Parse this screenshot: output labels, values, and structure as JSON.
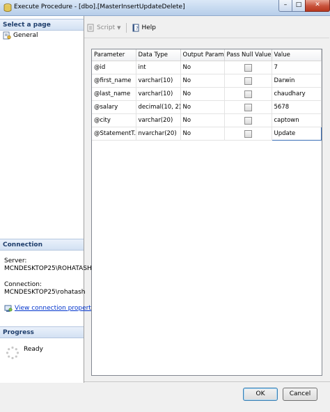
{
  "window": {
    "title": "Execute Procedure - [dbo].[MasterInsertUpdateDelete]",
    "controls": {
      "minimize": "–",
      "maximize": "□",
      "close": "✕"
    }
  },
  "left_pane": {
    "select_page": {
      "header": "Select a page",
      "items": [
        {
          "label": "General",
          "icon": "page-properties-icon"
        }
      ]
    },
    "connection": {
      "header": "Connection",
      "server_label": "Server:",
      "server_value": "MCNDESKTOP25\\ROHATASH",
      "connection_label": "Connection:",
      "connection_value": "MCNDESKTOP25\\rohatash",
      "view_link": "View connection properties"
    },
    "progress": {
      "header": "Progress",
      "status": "Ready"
    }
  },
  "toolbar": {
    "script_label": "Script",
    "help_label": "Help"
  },
  "grid": {
    "columns": [
      "Parameter",
      "Data Type",
      "Output Parame...",
      "Pass Null Value",
      "Value"
    ],
    "rows": [
      {
        "parameter": "@id",
        "data_type": "int",
        "output": "No",
        "pass_null": false,
        "value": "7"
      },
      {
        "parameter": "@first_name",
        "data_type": "varchar(10)",
        "output": "No",
        "pass_null": false,
        "value": "Darwin"
      },
      {
        "parameter": "@last_name",
        "data_type": "varchar(10)",
        "output": "No",
        "pass_null": false,
        "value": "chaudhary"
      },
      {
        "parameter": "@salary",
        "data_type": "decimal(10, 2)",
        "output": "No",
        "pass_null": false,
        "value": "5678"
      },
      {
        "parameter": "@city",
        "data_type": "varchar(20)",
        "output": "No",
        "pass_null": false,
        "value": "captown"
      },
      {
        "parameter": "@StatementT...",
        "data_type": "nvarchar(20)",
        "output": "No",
        "pass_null": false,
        "value": "Update"
      }
    ]
  },
  "buttons": {
    "ok": "OK",
    "cancel": "Cancel"
  },
  "colors": {
    "link": "#0033cc",
    "header_bg": "#d3e1f3",
    "close_button": "#c8513a"
  }
}
